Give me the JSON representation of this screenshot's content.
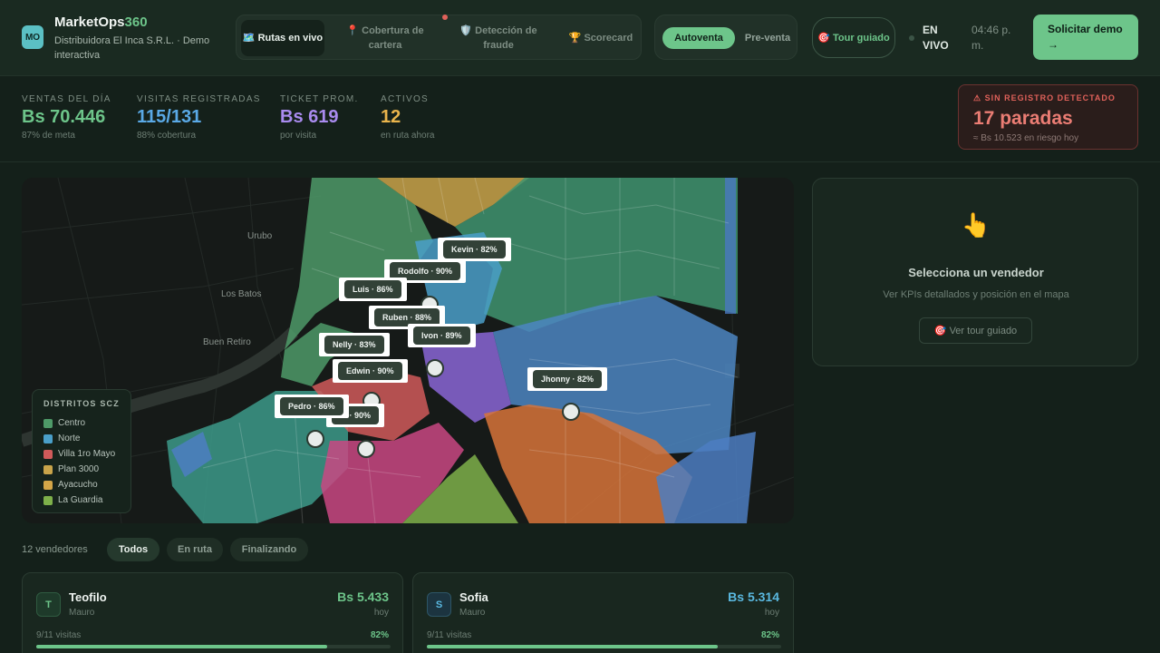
{
  "header": {
    "logo_initials": "MO",
    "brand_main": "MarketOps",
    "brand_accent": "360",
    "subtitle": "Distribuidora El Inca S.R.L. · Demo interactiva",
    "nav_tabs": [
      {
        "label": "🗺️ Rutas en vivo",
        "active": true
      },
      {
        "label": "📍 Cobertura de cartera",
        "active": false
      },
      {
        "label": "🛡️ Detección de fraude",
        "active": false
      },
      {
        "label": "🏆 Scorecard",
        "active": false
      }
    ],
    "modes": [
      {
        "label": "Autoventa",
        "active": true
      },
      {
        "label": "Pre-venta",
        "active": false
      }
    ],
    "tour_label": "🎯 Tour guiado",
    "live_label": "EN VIVO",
    "clock": "04:46 p. m.",
    "cta_label": "Solicitar demo →"
  },
  "kpis": [
    {
      "label": "VENTAS DEL DÍA",
      "value": "Bs 70.446",
      "sub": "87% de meta",
      "color": "#6dc58a"
    },
    {
      "label": "VISITAS REGISTRADAS",
      "value": "115/131",
      "sub": "88% cobertura",
      "color": "#5aa9e6"
    },
    {
      "label": "TICKET PROM.",
      "value": "Bs 619",
      "sub": "por visita",
      "color": "#a98bef"
    },
    {
      "label": "ACTIVOS",
      "value": "12",
      "sub": "en ruta ahora",
      "color": "#e9b44c"
    }
  ],
  "alert": {
    "title": "⚠ SIN REGISTRO DETECTADO",
    "value": "17 paradas",
    "sub": "≈ Bs 10.523 en riesgo hoy"
  },
  "map": {
    "places": [
      "Urubo",
      "Los Batos",
      "Buen Retiro"
    ],
    "vendors": [
      "Kevin · 82%",
      "Rodolfo · 90%",
      "Luis · 86%",
      "Ruben · 88%",
      "Ivon · 89%",
      "Nelly · 83%",
      "Edwin · 90%",
      "Pedro · 86%",
      "io · 90%",
      "Jhonny · 82%"
    ],
    "legend_title": "DISTRITOS SCZ",
    "districts": [
      {
        "name": "Centro",
        "color": "#4e9a68"
      },
      {
        "name": "Norte",
        "color": "#4a9fc9"
      },
      {
        "name": "Villa 1ro Mayo",
        "color": "#d05a5a"
      },
      {
        "name": "Plan 3000",
        "color": "#c9a44a"
      },
      {
        "name": "Ayacucho",
        "color": "#d4a648"
      },
      {
        "name": "La Guardia",
        "color": "#7eb04a"
      }
    ]
  },
  "panel": {
    "icon": "👆",
    "title": "Selecciona un vendedor",
    "subtitle": "Ver KPIs detallados y posición en el mapa",
    "button": "🎯 Ver tour guiado"
  },
  "list": {
    "count": "12 vendedores",
    "filters": [
      {
        "label": "Todos",
        "active": true
      },
      {
        "label": "En ruta",
        "active": false
      },
      {
        "label": "Finalizando",
        "active": false
      }
    ]
  },
  "cards": [
    {
      "initial": "T",
      "name": "Teofilo",
      "supervisor": "Mauro",
      "amount": "Bs 5.433",
      "hint": "hoy",
      "visits": "9/11 visitas",
      "pct": "82%",
      "progress": 0.82,
      "color": "#6dc58a"
    },
    {
      "initial": "S",
      "name": "Sofia",
      "supervisor": "Mauro",
      "amount": "Bs 5.314",
      "hint": "hoy",
      "visits": "9/11 visitas",
      "pct": "82%",
      "progress": 0.82,
      "color": "#5ab8e0"
    }
  ]
}
